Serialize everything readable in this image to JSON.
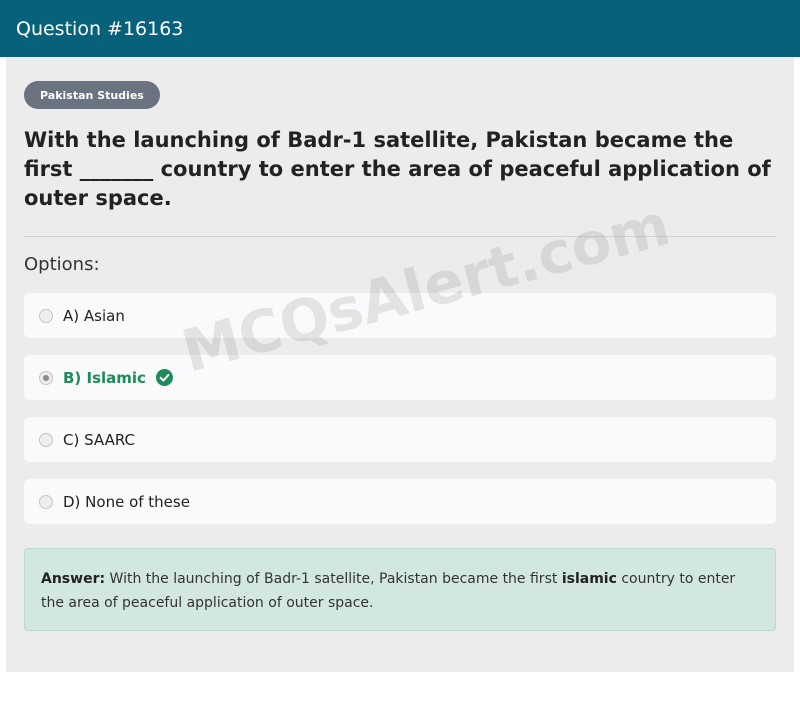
{
  "header": {
    "title": "Question #16163"
  },
  "tag": "Pakistan Studies",
  "question": "With the launching of Badr-1 satellite, Pakistan became the first _______ country to enter the area of peaceful application of outer space.",
  "options_label": "Options:",
  "options": [
    {
      "label": "A) Asian",
      "selected": false,
      "correct": false
    },
    {
      "label": "B) Islamic",
      "selected": true,
      "correct": true
    },
    {
      "label": "C) SAARC",
      "selected": false,
      "correct": false
    },
    {
      "label": "D) None of these",
      "selected": false,
      "correct": false
    }
  ],
  "answer": {
    "heading": "Answer:",
    "text_before": "With the launching of Badr-1 satellite, Pakistan became the first",
    "highlight": "islamic",
    "text_after": "country to enter the area of peaceful application of outer space."
  },
  "watermark": "MCQsAlert.com",
  "colors": {
    "header_bg": "#08617a",
    "correct": "#1f8a5a",
    "answer_bg": "#d2e8df",
    "tag_bg": "#6b7280"
  }
}
